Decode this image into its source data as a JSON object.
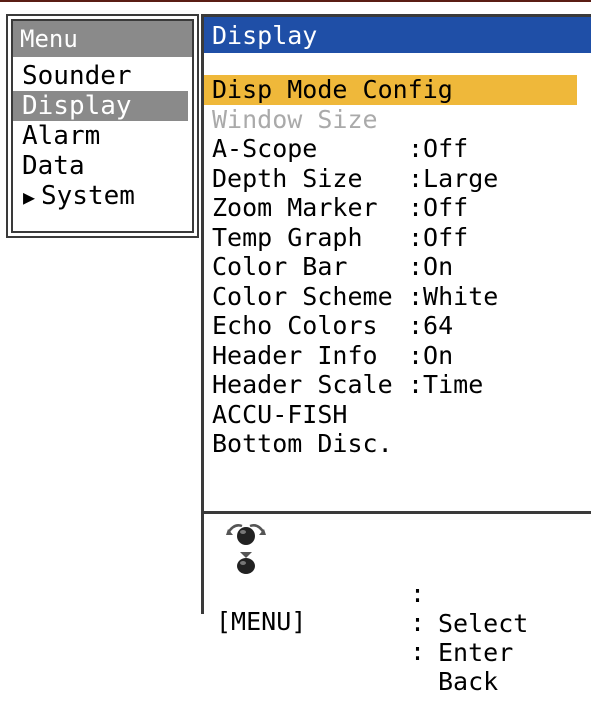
{
  "menu": {
    "title": "Menu",
    "items": [
      {
        "label": "Sounder"
      },
      {
        "label": "Display"
      },
      {
        "label": "Alarm"
      },
      {
        "label": "Data"
      },
      {
        "label": "System",
        "arrow": "▶"
      }
    ]
  },
  "display": {
    "title": "Display",
    "items": [
      {
        "label": "Disp Mode Config",
        "value": ""
      },
      {
        "label": "Window Size",
        "value": ""
      },
      {
        "label": "A-Scope",
        "value": ":Off"
      },
      {
        "label": "Depth Size",
        "value": ":Large"
      },
      {
        "label": "Zoom Marker",
        "value": ":Off"
      },
      {
        "label": "Temp Graph",
        "value": ":Off"
      },
      {
        "label": "Color Bar",
        "value": ":On"
      },
      {
        "label": "Color Scheme",
        "value": ":White"
      },
      {
        "label": "Echo Colors",
        "value": ":64"
      },
      {
        "label": "Header Info",
        "value": ":On"
      },
      {
        "label": "Header Scale",
        "value": ":Time"
      },
      {
        "label": "ACCU-FISH",
        "value": ""
      },
      {
        "label": "Bottom Disc.",
        "value": ""
      }
    ]
  },
  "help": [
    {
      "key_icon": "rotate-knob-icon",
      "colon": ":",
      "desc": "Select"
    },
    {
      "key_icon": "push-knob-icon",
      "colon": ":",
      "desc": "Enter"
    },
    {
      "key": "[MENU]",
      "colon": ":",
      "desc": "Back"
    }
  ],
  "colors": {
    "menu_header": "#8a8a8a",
    "display_header": "#1f4fa7",
    "highlight": "#efb83a",
    "disabled": "#aaaaaa"
  }
}
